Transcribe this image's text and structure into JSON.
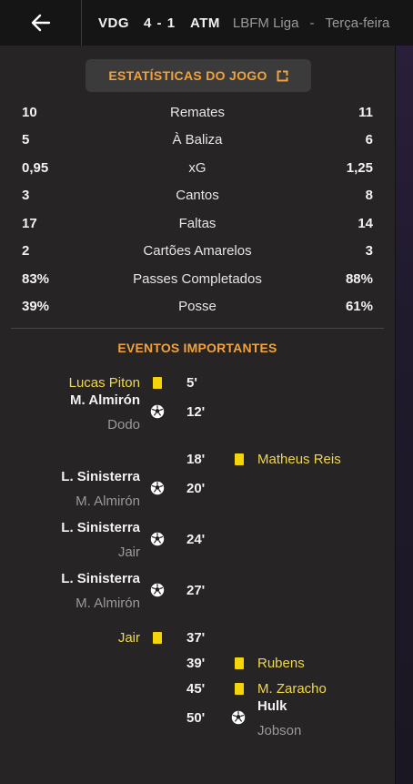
{
  "header": {
    "home_team": "VDG",
    "score": "4 - 1",
    "away_team": "ATM",
    "league": "LBFM Liga",
    "separator": "-",
    "date": "Terça-feira"
  },
  "stats_title": "ESTATÍSTICAS DO JOGO",
  "stats": [
    {
      "label": "Remates",
      "home": "10",
      "away": "11"
    },
    {
      "label": "À Baliza",
      "home": "5",
      "away": "6"
    },
    {
      "label": "xG",
      "home": "0,95",
      "away": "1,25"
    },
    {
      "label": "Cantos",
      "home": "3",
      "away": "8"
    },
    {
      "label": "Faltas",
      "home": "17",
      "away": "14"
    },
    {
      "label": "Cartões Amarelos",
      "home": "2",
      "away": "3"
    },
    {
      "label": "Passes Completados",
      "home": "83%",
      "away": "88%"
    },
    {
      "label": "Posse",
      "home": "39%",
      "away": "61%"
    }
  ],
  "events_title": "EVENTOS IMPORTANTES",
  "events": [
    {
      "side": "home",
      "type": "yellow",
      "minute": "5'",
      "player": "Lucas Piton"
    },
    {
      "side": "home",
      "type": "goal",
      "minute": "12'",
      "player": "M. Almirón",
      "assist": "Dodo"
    },
    {
      "side": "away",
      "type": "yellow",
      "minute": "18'",
      "player": "Matheus Reis"
    },
    {
      "side": "home",
      "type": "goal",
      "minute": "20'",
      "player": "L. Sinisterra",
      "assist": "M. Almirón"
    },
    {
      "side": "home",
      "type": "goal",
      "minute": "24'",
      "player": "L. Sinisterra",
      "assist": "Jair"
    },
    {
      "side": "home",
      "type": "goal",
      "minute": "27'",
      "player": "L. Sinisterra",
      "assist": "M. Almirón"
    },
    {
      "side": "home",
      "type": "yellow",
      "minute": "37'",
      "player": "Jair"
    },
    {
      "side": "away",
      "type": "yellow",
      "minute": "39'",
      "player": "Rubens"
    },
    {
      "side": "away",
      "type": "yellow",
      "minute": "45'",
      "player": "M. Zaracho"
    },
    {
      "side": "away",
      "type": "goal",
      "minute": "50'",
      "player": "Hulk",
      "assist": "Jobson"
    }
  ],
  "colors": {
    "accent": "#f2a23c",
    "yellow_card": "#f5d50a",
    "yellow_text": "#f0d84a"
  }
}
